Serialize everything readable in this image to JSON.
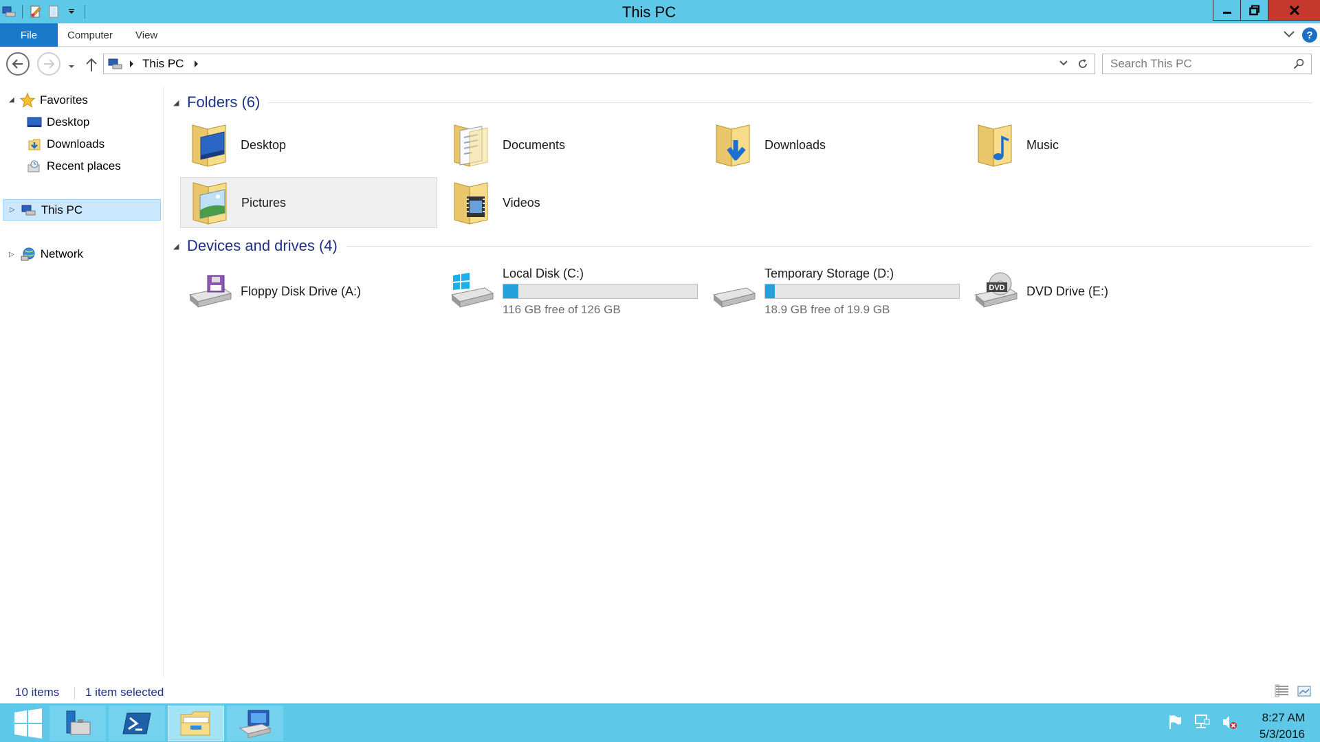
{
  "window": {
    "title": "This PC"
  },
  "ribbon": {
    "tabs": [
      "File",
      "Computer",
      "View"
    ]
  },
  "address": {
    "crumb": "This PC",
    "search_placeholder": "Search This PC"
  },
  "navpane": {
    "favorites": "Favorites",
    "items": [
      "Desktop",
      "Downloads",
      "Recent places"
    ],
    "this_pc": "This PC",
    "network": "Network"
  },
  "folders": {
    "header": "Folders (6)",
    "items": [
      {
        "name": "Desktop",
        "icon": "desktop-folder-icon"
      },
      {
        "name": "Documents",
        "icon": "documents-folder-icon"
      },
      {
        "name": "Downloads",
        "icon": "downloads-folder-icon"
      },
      {
        "name": "Music",
        "icon": "music-folder-icon"
      },
      {
        "name": "Pictures",
        "icon": "pictures-folder-icon",
        "selected": true
      },
      {
        "name": "Videos",
        "icon": "videos-folder-icon"
      }
    ]
  },
  "devices": {
    "header": "Devices and drives (4)",
    "items": [
      {
        "name": "Floppy Disk Drive (A:)",
        "icon": "floppy-drive-icon"
      },
      {
        "name": "Local Disk (C:)",
        "icon": "system-drive-icon",
        "free": "116 GB free of 126 GB",
        "used_fraction": 0.079
      },
      {
        "name": "Temporary Storage (D:)",
        "icon": "hard-drive-icon",
        "free": "18.9 GB free of 19.9 GB",
        "used_fraction": 0.05
      },
      {
        "name": "DVD Drive (E:)",
        "icon": "dvd-drive-icon",
        "dvd_label": "DVD"
      }
    ]
  },
  "status": {
    "count": "10 items",
    "selected": "1 item selected"
  },
  "taskbar": {
    "time": "8:27 AM",
    "date": "5/3/2016"
  },
  "colors": {
    "titlebar": "#5ec8e9",
    "file_tab": "#1979ca",
    "accent_text": "#1e3287",
    "drive_bar": "#26a0da",
    "close": "#c7382c"
  }
}
